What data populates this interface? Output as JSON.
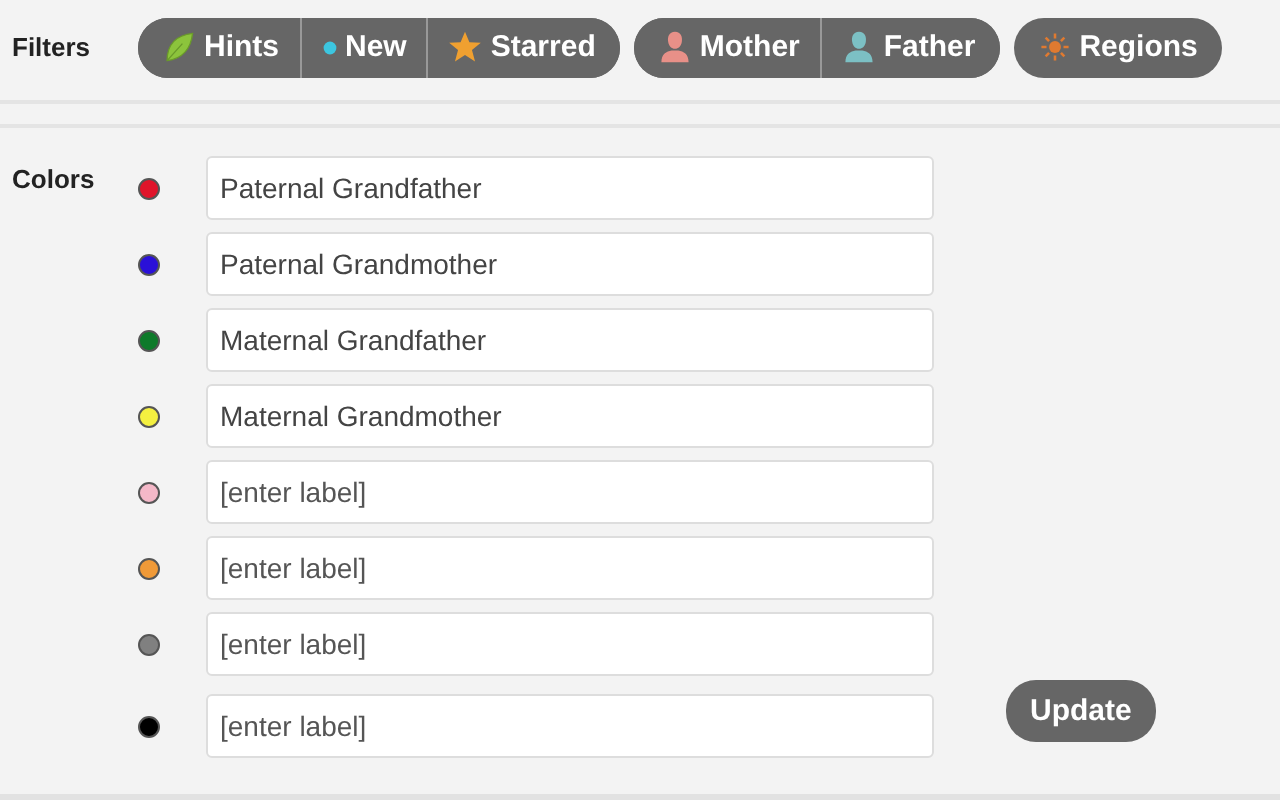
{
  "filters": {
    "label": "Filters",
    "groups": [
      [
        {
          "kind": "leaf",
          "label": "Hints"
        },
        {
          "kind": "dot",
          "label": "New"
        },
        {
          "kind": "star",
          "label": "Starred"
        }
      ],
      [
        {
          "kind": "mother",
          "label": "Mother"
        },
        {
          "kind": "father",
          "label": "Father"
        }
      ],
      [
        {
          "kind": "sun",
          "label": "Regions"
        }
      ]
    ]
  },
  "colors": {
    "label": "Colors",
    "items": [
      {
        "color": "#e0142a",
        "value": "Paternal Grandfather"
      },
      {
        "color": "#2a10d8",
        "value": "Paternal Grandmother"
      },
      {
        "color": "#0e7a2a",
        "value": "Maternal Grandfather"
      },
      {
        "color": "#f4f040",
        "value": "Maternal Grandmother"
      },
      {
        "color": "#f4b8c8",
        "placeholder": "[enter label]"
      },
      {
        "color": "#f09a38",
        "placeholder": "[enter label]"
      },
      {
        "color": "#808080",
        "placeholder": "[enter label]"
      },
      {
        "color": "#000000",
        "placeholder": "[enter label]"
      }
    ]
  },
  "update_button": "Update"
}
